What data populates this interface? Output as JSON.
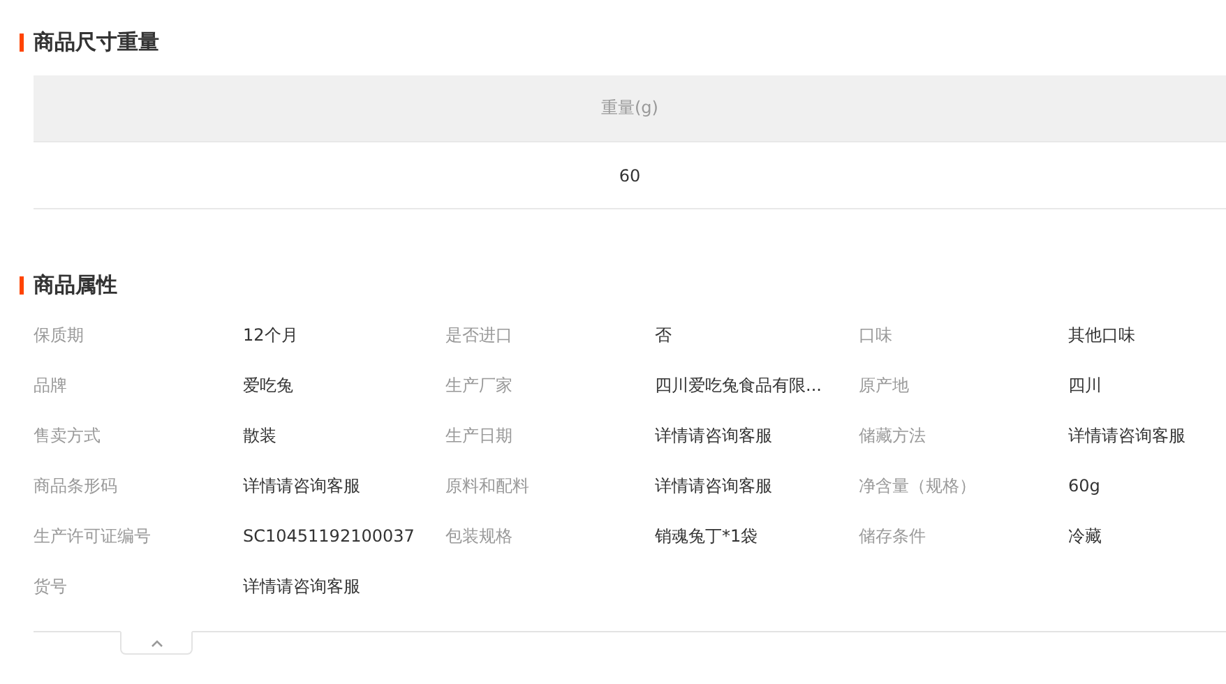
{
  "size_weight": {
    "title": "商品尺寸重量",
    "columns": [
      "重量(g)"
    ],
    "rows": [
      [
        "60"
      ]
    ]
  },
  "attributes": {
    "title": "商品属性",
    "items": [
      {
        "label": "保质期",
        "value": "12个月"
      },
      {
        "label": "是否进口",
        "value": "否"
      },
      {
        "label": "口味",
        "value": "其他口味"
      },
      {
        "label": "品牌",
        "value": "爱吃兔"
      },
      {
        "label": "生产厂家",
        "value": "四川爱吃兔食品有限..."
      },
      {
        "label": "原产地",
        "value": "四川"
      },
      {
        "label": "售卖方式",
        "value": "散装"
      },
      {
        "label": "生产日期",
        "value": "详情请咨询客服"
      },
      {
        "label": "储藏方法",
        "value": "详情请咨询客服"
      },
      {
        "label": "商品条形码",
        "value": "详情请咨询客服"
      },
      {
        "label": "原料和配料",
        "value": "详情请咨询客服"
      },
      {
        "label": "净含量（规格）",
        "value": "60g"
      },
      {
        "label": "生产许可证编号",
        "value": "SC10451192100037"
      },
      {
        "label": "包装规格",
        "value": "销魂兔丁*1袋"
      },
      {
        "label": "储存条件",
        "value": "冷藏"
      },
      {
        "label": "货号",
        "value": "详情请咨询客服"
      }
    ]
  },
  "collapse": {
    "expanded": true
  }
}
